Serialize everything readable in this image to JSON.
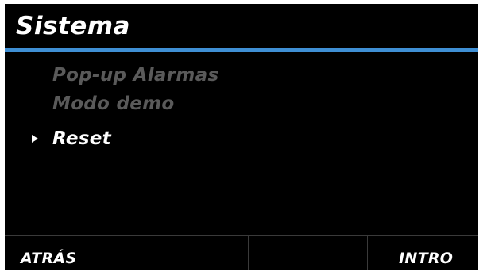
{
  "header": {
    "title": "Sistema",
    "accent_color": "#3f8fd4"
  },
  "menu": {
    "items": [
      {
        "label": "Pop-up Alarmas",
        "state": "disabled"
      },
      {
        "label": "Modo demo",
        "state": "disabled"
      },
      {
        "label": "Reset",
        "state": "selected"
      }
    ],
    "cursor_icon": "triangle-right-icon"
  },
  "softkeys": {
    "left_label": "ATRÁS",
    "mid_left_label": "",
    "mid_right_label": "",
    "right_label": "INTRO"
  }
}
